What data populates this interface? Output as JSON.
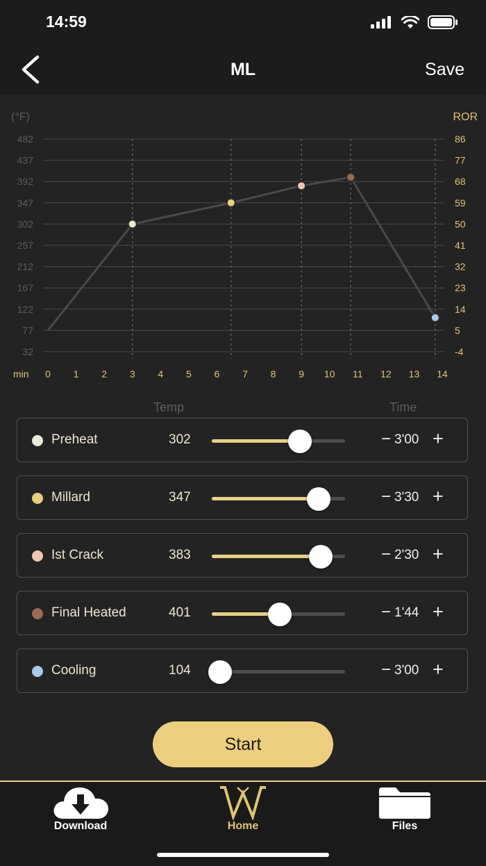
{
  "status_bar": {
    "time": "14:59"
  },
  "nav": {
    "back_icon": "chevron-left-icon",
    "title": "ML",
    "save_label": "Save"
  },
  "chart_data": {
    "type": "line",
    "left_axis_label": "(°F)",
    "right_axis_label": "ROR",
    "x_unit_label": "min",
    "x_ticks": [
      "0",
      "1",
      "2",
      "3",
      "4",
      "5",
      "6",
      "7",
      "8",
      "9",
      "10",
      "11",
      "12",
      "13",
      "14"
    ],
    "y_ticks_left": [
      "482",
      "437",
      "392",
      "347",
      "302",
      "257",
      "212",
      "167",
      "122",
      "77",
      "32"
    ],
    "y_ticks_right": [
      "86",
      "77",
      "68",
      "59",
      "50",
      "41",
      "32",
      "23",
      "14",
      "5",
      "-4"
    ],
    "xlim": [
      0,
      14
    ],
    "ylim": [
      32,
      482
    ],
    "grid": true,
    "series": [
      {
        "x": [
          0,
          3,
          6.5,
          9,
          10.75,
          13.75
        ],
        "y": [
          77,
          302,
          347,
          383,
          401,
          104
        ],
        "line_color": "#4a4a4a",
        "point_colors": [
          "",
          "#e8ecd6",
          "#ebcf7f",
          "#efc8b0",
          "#9a6b57",
          "#a7c9ec"
        ]
      }
    ]
  },
  "columns": {
    "temp": "Temp",
    "time": "Time"
  },
  "stages": [
    {
      "name": "Preheat",
      "temp": "302",
      "time": "3'00",
      "color": "#e8ecd6",
      "slider": 0.66
    },
    {
      "name": "Millard",
      "temp": "347",
      "time": "3'30",
      "color": "#ebcf7f",
      "slider": 0.8
    },
    {
      "name": "Ist Crack",
      "temp": "383",
      "time": "2'30",
      "color": "#efc8b0",
      "slider": 0.82
    },
    {
      "name": "Final Heated",
      "temp": "401",
      "time": "1'44",
      "color": "#9a6b57",
      "slider": 0.51
    },
    {
      "name": "Cooling",
      "temp": "104",
      "time": "3'00",
      "color": "#a7c9ec",
      "slider": 0.06
    }
  ],
  "controls": {
    "minus": "−",
    "plus": "+"
  },
  "start_label": "Start",
  "tabs": [
    {
      "label": "Download",
      "icon": "cloud-download-icon"
    },
    {
      "label": "Home",
      "icon": "brand-logo-icon"
    },
    {
      "label": "Files",
      "icon": "folder-icon"
    }
  ],
  "colors": {
    "accent": "#ebcf7f",
    "background": "#232323"
  }
}
